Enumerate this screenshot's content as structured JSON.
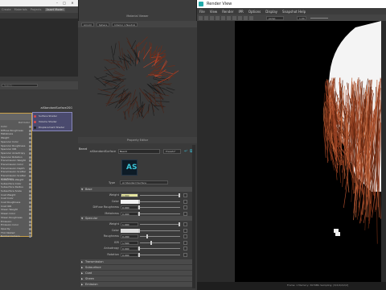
{
  "hypershade": {
    "tabs": [
      "Create",
      "Materials",
      "Projects",
      "Asset Model"
    ],
    "active_tab_index": 3,
    "search_placeholder": "Search...",
    "node1": {
      "output_label": "Out Color",
      "rows": [
        "Color",
        "Diffuse Roughness",
        "Metalness",
        "Weight",
        "Specular Color",
        "Specular Roughness",
        "Specular IOR",
        "Specular Anisotropy",
        "Specular Rotation",
        "Transmission Weight",
        "Transmission Color",
        "Transmission Depth",
        "Transmission Scatter",
        "Transmission Scatter Anisotropy",
        "Subsurface Weight",
        "Subsurface Color",
        "Subsurface Radius",
        "Subsurface Scale",
        "Coat Weight",
        "Coat Color",
        "Coat Roughness",
        "Coat IOR",
        "Sheen Weight",
        "Sheen Color",
        "Sheen Roughness",
        "Emission",
        "Emission Color",
        "Opacity",
        "Thin Walled",
        "Normal Camera"
      ]
    },
    "node2": {
      "title": "aiStandardSurface2SG",
      "pins": [
        {
          "label": "Surface Shader",
          "color": "#d94a4a"
        },
        {
          "label": "Volume Shader",
          "color": "#d94a4a"
        },
        {
          "label": "Displacement Shader",
          "color": "#222222"
        }
      ]
    }
  },
  "swatch": {
    "title": "Material Viewer",
    "renderer": "Arnold",
    "shape": "Sphere",
    "env": "Interior 1 Neutral"
  },
  "property_editor": {
    "title": "Property Editor",
    "material_name": "Beard",
    "node_type": "aiStandardSurface",
    "node_type_short": "AS",
    "presets_button": "Presets*",
    "type_label": "Type",
    "type_value": "AI Standard Surface",
    "sections": {
      "base": "Base",
      "specular": "Specular",
      "transmission": "Transmission",
      "subsurface": "Subsurface",
      "coat": "Coat",
      "sheen": "Sheen",
      "emission": "Emission"
    },
    "base_fields": [
      {
        "label": "Weight",
        "value": "1.000",
        "fill": 1.0
      },
      {
        "label": "Color",
        "value": "",
        "fill": 0
      },
      {
        "label": "Diffuse Roughness",
        "value": "0.000",
        "fill": 0
      },
      {
        "label": "Metalness",
        "value": "0.000",
        "fill": 0
      }
    ],
    "specular_fields": [
      {
        "label": "Weight",
        "value": "1.000",
        "fill": 1.0
      },
      {
        "label": "Color",
        "value": "",
        "fill": 0
      },
      {
        "label": "Roughness",
        "value": "0.200",
        "fill": 0.2
      },
      {
        "label": "IOR",
        "value": "1.500",
        "fill": 0.3
      },
      {
        "label": "Anisotropy",
        "value": "0.000",
        "fill": 0
      },
      {
        "label": "Rotation",
        "value": "0.000",
        "fill": 0
      }
    ]
  },
  "render_view": {
    "title": "Render View",
    "menus": [
      "File",
      "View",
      "Render",
      "IPR",
      "Options",
      "Display",
      "Snapshot Help"
    ],
    "camera": "persp",
    "zoom": "1.00",
    "status_text": "Frame: 1   Memory: 3979Mb   Sampling: [3/2/2/2/2/2]"
  },
  "colors": {
    "accent_border": "#c9a14a",
    "shading_group": "#4a4a6e",
    "beard": "#8a3a1c",
    "head": "#f2f2f2"
  }
}
